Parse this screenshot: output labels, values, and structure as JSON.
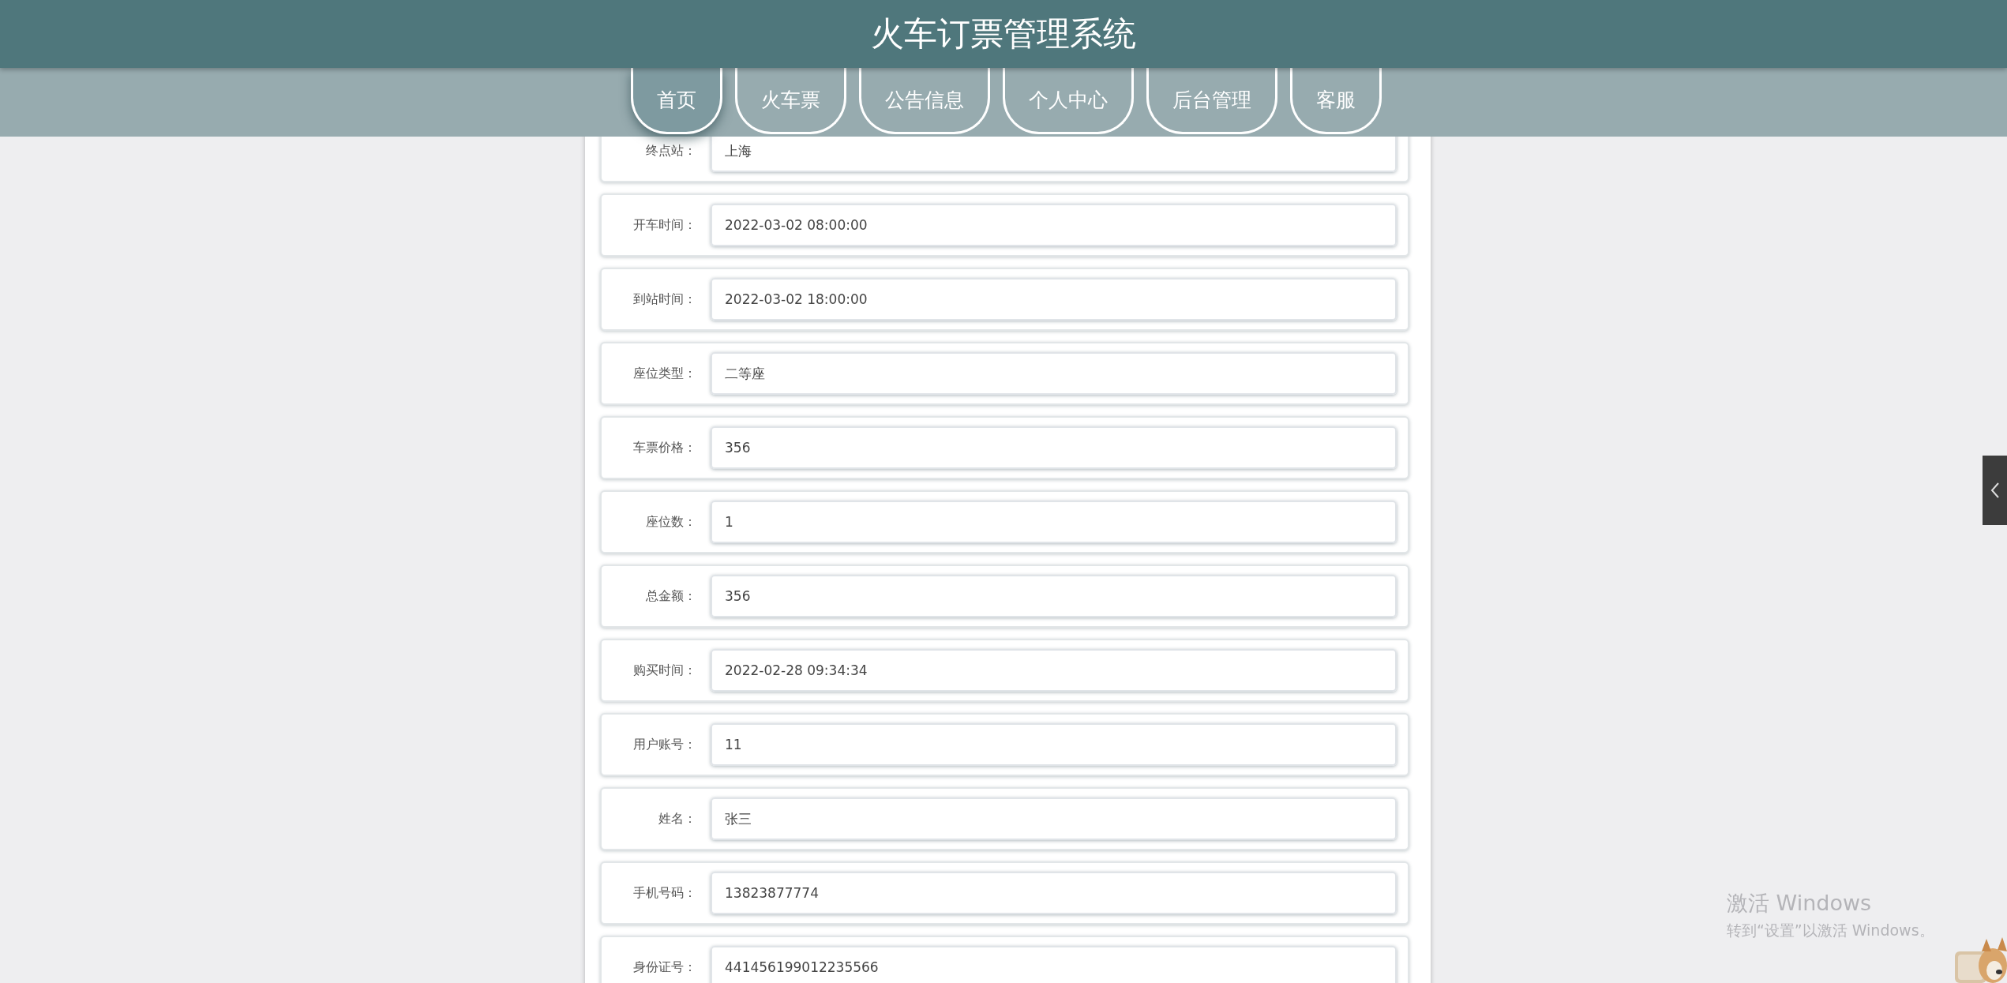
{
  "header": {
    "title": "火车订票管理系统"
  },
  "nav": [
    {
      "label": "首页",
      "selected": true
    },
    {
      "label": "火车票",
      "selected": false
    },
    {
      "label": "公告信息",
      "selected": false
    },
    {
      "label": "个人中心",
      "selected": false
    },
    {
      "label": "后台管理",
      "selected": false
    },
    {
      "label": "客服",
      "selected": false
    }
  ],
  "form": [
    {
      "label": "终点站：",
      "value": "上海"
    },
    {
      "label": "开车时间：",
      "value": "2022-03-02 08:00:00"
    },
    {
      "label": "到站时间：",
      "value": "2022-03-02 18:00:00"
    },
    {
      "label": "座位类型：",
      "value": "二等座"
    },
    {
      "label": "车票价格：",
      "value": "356"
    },
    {
      "label": "座位数：",
      "value": "1"
    },
    {
      "label": "总金额：",
      "value": "356"
    },
    {
      "label": "购买时间：",
      "value": "2022-02-28 09:34:34"
    },
    {
      "label": "用户账号：",
      "value": "11"
    },
    {
      "label": "姓名：",
      "value": "张三"
    },
    {
      "label": "手机号码：",
      "value": "13823877774"
    },
    {
      "label": "身份证号：",
      "value": "441456199012235566"
    }
  ],
  "side_tab": {
    "expanded": false
  },
  "activation_notice": {
    "title": "激活 Windows",
    "subtitle": "转到“设置”以激活 Windows。"
  }
}
